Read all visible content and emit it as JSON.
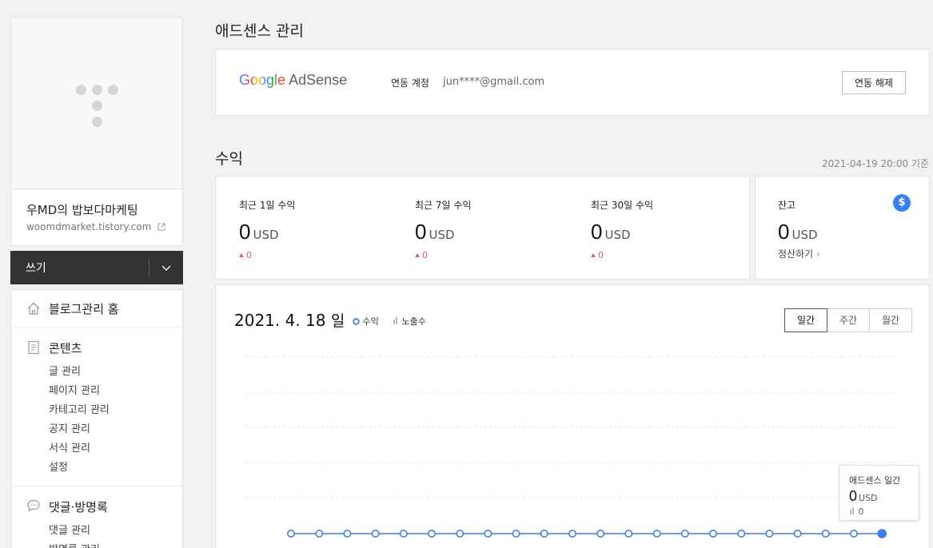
{
  "blog": {
    "name": "우MD의 밥보다마케팅",
    "url": "woomdmarket.tistory.com"
  },
  "write": {
    "label": "쓰기"
  },
  "menu": {
    "home": "블로그관리 홈",
    "contents": {
      "title": "콘텐츠",
      "items": [
        "글 관리",
        "페이지 관리",
        "카테고리 관리",
        "공지 관리",
        "서식 관리",
        "설정"
      ]
    },
    "comments": {
      "title": "댓글·방명록",
      "items": [
        "댓글 관리",
        "방명록 관리"
      ]
    }
  },
  "adsense": {
    "page_title": "애드센스 관리",
    "logo_google": "Google",
    "logo_adsense": "AdSense",
    "linked_label": "연동 계정",
    "linked_account": "jun****@gmail.com",
    "unlink_button": "연동 해제"
  },
  "revenue": {
    "title": "수익",
    "timestamp": "2021-04-19 20:00 기준",
    "stats": [
      {
        "label": "최근 1일 수익",
        "value": "0",
        "unit": "USD",
        "change": "0"
      },
      {
        "label": "최근 7일 수익",
        "value": "0",
        "unit": "USD",
        "change": "0"
      },
      {
        "label": "최근 30일 수익",
        "value": "0",
        "unit": "USD",
        "change": "0"
      }
    ],
    "balance": {
      "label": "잔고",
      "value": "0",
      "unit": "USD",
      "settle_link": "정산하기",
      "icon": "dollar-icon"
    }
  },
  "chart": {
    "date": "2021. 4. 18",
    "day": "일",
    "legend_revenue": "수익",
    "legend_impressions": "노출수",
    "tabs": [
      "일간",
      "주간",
      "월간"
    ],
    "active_tab": "일간",
    "tooltip": {
      "title": "애드센스 일간",
      "value": "0",
      "unit": "USD",
      "impressions": "0"
    }
  },
  "chart_data": {
    "type": "line",
    "series": [
      {
        "name": "수익",
        "values": [
          0,
          0,
          0,
          0,
          0,
          0,
          0,
          0,
          0,
          0,
          0,
          0,
          0,
          0,
          0,
          0,
          0,
          0,
          0,
          0,
          0,
          0
        ]
      }
    ],
    "highlighted_index": 21,
    "grid": true,
    "colors": {
      "line": "#3c7ef3"
    }
  }
}
